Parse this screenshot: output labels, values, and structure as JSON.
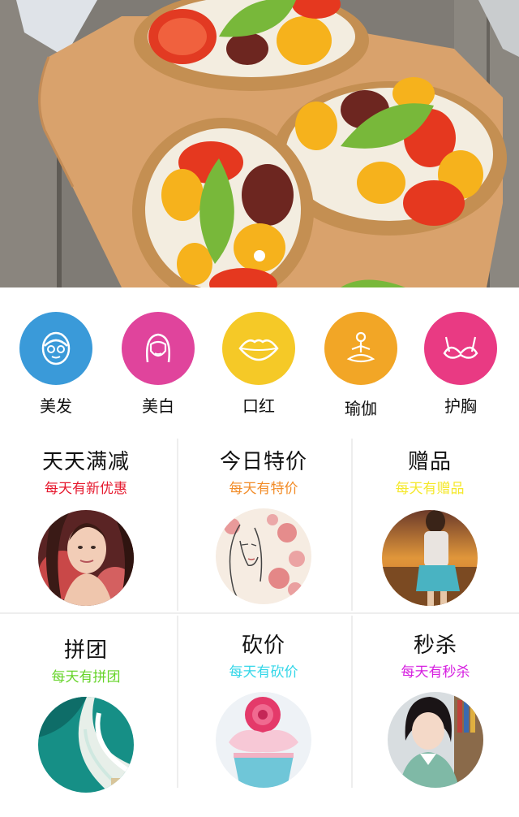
{
  "banner": {
    "image": "bruschetta-with-tomatoes-and-basil-photo",
    "active_slide": 1,
    "slide_count": 1
  },
  "categories": [
    {
      "label": "美发",
      "icon": "face-mask-icon",
      "color": "#3a9ad9"
    },
    {
      "label": "美白",
      "icon": "woman-face-icon",
      "color": "#e0449c"
    },
    {
      "label": "口红",
      "icon": "lips-icon",
      "color": "#f5c927"
    },
    {
      "label": "瑜伽",
      "icon": "yoga-pose-icon",
      "color": "#f2a626"
    },
    {
      "label": "护胸",
      "icon": "bra-icon",
      "color": "#e93a83"
    }
  ],
  "promos": [
    {
      "title": "天天满减",
      "subtitle": "每天有新优惠",
      "subtitle_color": "#e6192e",
      "image": "woman-portrait-photo"
    },
    {
      "title": "今日特价",
      "subtitle": "每天有特价",
      "subtitle_color": "#f28c28",
      "image": "roses-illustration-woman"
    },
    {
      "title": "赠品",
      "subtitle": "每天有赠品",
      "subtitle_color": "#f5e82a",
      "image": "girl-sunset-field-photo"
    },
    {
      "title": "拼团",
      "subtitle": "每天有拼团",
      "subtitle_color": "#66d42a",
      "image": "ocean-waves-aerial-photo"
    },
    {
      "title": "砍价",
      "subtitle": "每天有砍价",
      "subtitle_color": "#33d6e8",
      "image": "rose-cupcake-photo"
    },
    {
      "title": "秒杀",
      "subtitle": "每天有秒杀",
      "subtitle_color": "#d61ee0",
      "image": "girl-reading-photo"
    }
  ]
}
